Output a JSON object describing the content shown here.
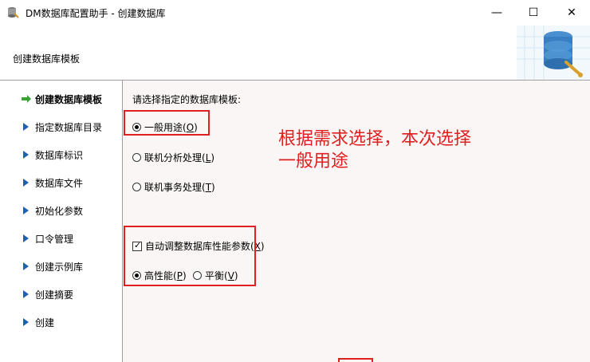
{
  "window": {
    "title": "DM数据库配置助手 - 创建数据库",
    "minimize": "—",
    "maximize": "☐",
    "close": "✕"
  },
  "header": {
    "title": "创建数据库模板"
  },
  "sidebar": {
    "items": [
      {
        "label": "创建数据库模板",
        "active": true
      },
      {
        "label": "指定数据库目录"
      },
      {
        "label": "数据库标识"
      },
      {
        "label": "数据库文件"
      },
      {
        "label": "初始化参数"
      },
      {
        "label": "口令管理"
      },
      {
        "label": "创建示例库"
      },
      {
        "label": "创建摘要"
      },
      {
        "label": "创建"
      }
    ]
  },
  "main": {
    "prompt": "请选择指定的数据库模板:",
    "templates": [
      {
        "label": "一般用途(",
        "key": "O",
        "suffix": ")",
        "selected": true
      },
      {
        "label": "联机分析处理(",
        "key": "L",
        "suffix": ")",
        "selected": false
      },
      {
        "label": "联机事务处理(",
        "key": "T",
        "suffix": ")",
        "selected": false
      }
    ],
    "auto_tune": {
      "label": "自动调整数据库性能参数(",
      "key": "X",
      "suffix": ")",
      "checked": true
    },
    "perf": [
      {
        "label": "高性能(",
        "key": "P",
        "suffix": ")",
        "selected": true
      },
      {
        "label": "平衡(",
        "key": "V",
        "suffix": ")",
        "selected": false
      }
    ]
  },
  "annotation": {
    "line1": "根据需求选择，本次选择",
    "line2": "一般用途"
  },
  "colors": {
    "annotation": "#e02020",
    "arrow_active": "#3aa335",
    "arrow": "#1f5fb4"
  }
}
